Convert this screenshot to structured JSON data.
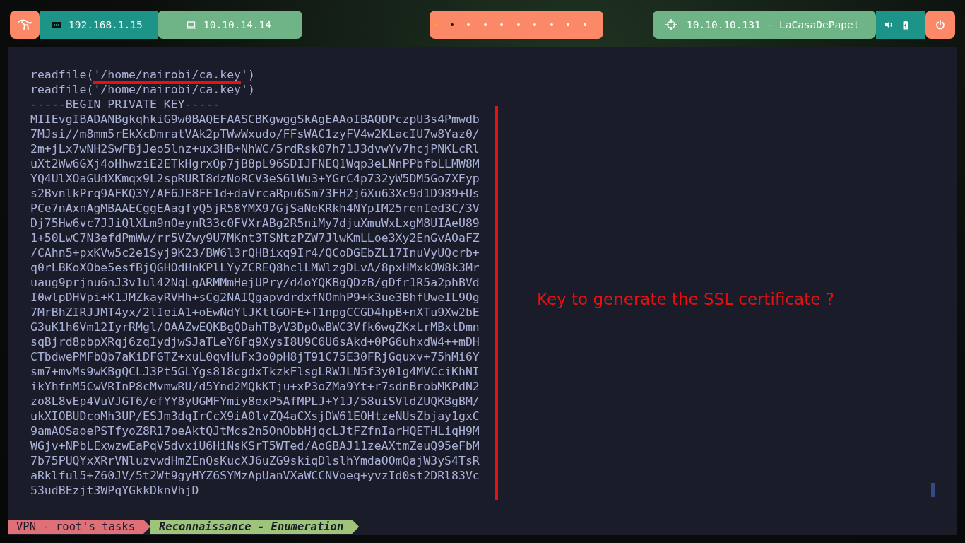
{
  "top_bar": {
    "local_ip": "192.168.1.15",
    "vpn_ip": "10.10.14.14",
    "workspaces": [
      {
        "kind": "active"
      },
      {
        "kind": "occupied"
      },
      {
        "kind": "empty"
      },
      {
        "kind": "empty"
      },
      {
        "kind": "empty"
      },
      {
        "kind": "empty"
      },
      {
        "kind": "empty"
      },
      {
        "kind": "empty"
      },
      {
        "kind": "empty"
      },
      {
        "kind": "empty"
      }
    ],
    "target": "10.10.10.131 - LaCasaDePapel"
  },
  "terminal": {
    "lines": [
      {
        "parts": [
          {
            "text": "readfile(",
            "marked": false
          },
          {
            "text": "'/home/nairobi/ca.key",
            "marked": true
          },
          {
            "text": "')",
            "marked": false
          }
        ]
      },
      {
        "parts": [
          {
            "text": "readfile('/home/nairobi/ca.key')",
            "marked": false
          }
        ]
      },
      {
        "parts": [
          {
            "text": "-----BEGIN PRIVATE KEY-----",
            "marked": false
          }
        ]
      },
      {
        "parts": [
          {
            "text": "MIIEvgIBADANBgkqhkiG9w0BAQEFAASCBKgwggSkAgEAAoIBAQDPczpU3s4Pmwdb",
            "marked": false
          }
        ]
      },
      {
        "parts": [
          {
            "text": "7MJsi//m8mm5rEkXcDmratVAk2pTWwWxudo/FFsWAC1zyFV4w2KLacIU7w8Yaz0/",
            "marked": false
          }
        ]
      },
      {
        "parts": [
          {
            "text": "2m+jLx7wNH2SwFBjJeo5lnz+ux3HB+NhWC/5rdRsk07h71J3dvwYv7hcjPNKLcRl",
            "marked": false
          }
        ]
      },
      {
        "parts": [
          {
            "text": "uXt2Ww6GXj4oHhwziE2ETkHgrxQp7jB8pL96SDIJFNEQ1Wqp3eLNnPPbfbLLMW8M",
            "marked": false
          }
        ]
      },
      {
        "parts": [
          {
            "text": "YQ4UlXOaGUdXKmqx9L2spRURI8dzNoRCV3eS6lWu3+YGrC4p732yW5DM5Go7XEyp",
            "marked": false
          }
        ]
      },
      {
        "parts": [
          {
            "text": "s2BvnlkPrq9AFKQ3Y/AF6JE8FE1d+daVrcaRpu6Sm73FH2j6Xu63Xc9d1D989+Us",
            "marked": false
          }
        ]
      },
      {
        "parts": [
          {
            "text": "PCe7nAxnAgMBAAECggEAagfyQ5jR58YMX97GjSaNeKRkh4NYpIM25renIed3C/3V",
            "marked": false
          }
        ]
      },
      {
        "parts": [
          {
            "text": "Dj75Hw6vc7JJiQlXLm9nOeynR33c0FVXrABg2R5niMy7djuXmuWxLxgM8UIAeU89",
            "marked": false
          }
        ]
      },
      {
        "parts": [
          {
            "text": "1+50LwC7N3efdPmWw/rr5VZwy9U7MKnt3TSNtzPZW7JlwKmLLoe3Xy2EnGvAOaFZ",
            "marked": false
          }
        ]
      },
      {
        "parts": [
          {
            "text": "/CAhn5+pxKVw5c2e1Syj9K23/BW6l3rQHBixq9Ir4/QCoDGEbZL17InuVyUQcrb+",
            "marked": false
          }
        ]
      },
      {
        "parts": [
          {
            "text": "q0rLBKoXObe5esfBjQGHOdHnKPlLYyZCREQ8hclLMWlzgDLvA/8pxHMxkOW8k3Mr",
            "marked": false
          }
        ]
      },
      {
        "parts": [
          {
            "text": "uaug9prjnu6nJ3v1ul42NqLgARMMmHejUPry/d4oYQKBgQDzB/gDfr1R5a2phBVd",
            "marked": false
          }
        ]
      },
      {
        "parts": [
          {
            "text": "I0wlpDHVpi+K1JMZkayRVHh+sCg2NAIQgapvdrdxfNOmhP9+k3ue3BhfUweIL9Og",
            "marked": false
          }
        ]
      },
      {
        "parts": [
          {
            "text": "7MrBhZIRJJMT4yx/2lIeiA1+oEwNdYlJKtlGOFE+T1npgCCGD4hpB+nXTu9Xw2bE",
            "marked": false
          }
        ]
      },
      {
        "parts": [
          {
            "text": "G3uK1h6Vm12IyrRMgl/OAAZwEQKBgQDahTByV3DpOwBWC3Vfk6wqZKxLrMBxtDmn",
            "marked": false
          }
        ]
      },
      {
        "parts": [
          {
            "text": "sqBjrd8pbpXRqj6zqIydjwSJaTLeY6Fq9XysI8U9C6U6sAkd+0PG6uhxdW4++mDH",
            "marked": false
          }
        ]
      },
      {
        "parts": [
          {
            "text": "CTbdwePMFbQb7aKiDFGTZ+xuL0qvHuFx3o0pH8jT91C75E30FRjGquxv+75hMi6Y",
            "marked": false
          }
        ]
      },
      {
        "parts": [
          {
            "text": "sm7+mvMs9wKBgQCLJ3Pt5GLYgs818cgdxTkzkFlsgLRWJLN5f3y01g4MVCciKhNI",
            "marked": false
          }
        ]
      },
      {
        "parts": [
          {
            "text": "ikYhfnM5CwVRInP8cMvmwRU/d5Ynd2MQkKTju+xP3oZMa9Yt+r7sdnBrobMKPdN2",
            "marked": false
          }
        ]
      },
      {
        "parts": [
          {
            "text": "zo8L8vEp4VuVJGT6/efYY8yUGMFYmiy8exP5AfMPLJ+Y1J/58uiSVldZUQKBgBM/",
            "marked": false
          }
        ]
      },
      {
        "parts": [
          {
            "text": "ukXIOBUDcoMh3UP/ESJm3dqIrCcX9iA0lvZQ4aCXsjDW61EOHtzeNUsZbjay1gxC",
            "marked": false
          }
        ]
      },
      {
        "parts": [
          {
            "text": "9amAOSaoePSTfyoZ8R17oeAktQJtMcs2n5OnObbHjqcLJtFZfnIarHQETHLiqH9M",
            "marked": false
          }
        ]
      },
      {
        "parts": [
          {
            "text": "WGjv+NPbLExwzwEaPqV5dvxiU6HiNsKSrT5WTed/AoGBAJ11zeAXtmZeuQ95eFbM",
            "marked": false
          }
        ]
      },
      {
        "parts": [
          {
            "text": "7b75PUQYxXRrVNluzvwdHmZEnQsKucXJ6uZG9skiqDlslhYmdaOOmQajW3yS4TsR",
            "marked": false
          }
        ]
      },
      {
        "parts": [
          {
            "text": "aRklful5+Z60JV/5t2Wt9gyHYZ6SYMzApUanVXaWCCNVoeq+yvzId0st2DRl83Vc",
            "marked": false
          }
        ]
      },
      {
        "parts": [
          {
            "text": "53udBEzjt3WPqYGkkDknVhjD",
            "marked": false
          }
        ]
      }
    ],
    "annotation": "Key to generate the SSL certificate ?"
  },
  "status_bar": {
    "segments": [
      {
        "text": "VPN - root's tasks",
        "selected": false
      },
      {
        "text": "Reconnaissance - Enumeration",
        "selected": true
      }
    ]
  }
}
